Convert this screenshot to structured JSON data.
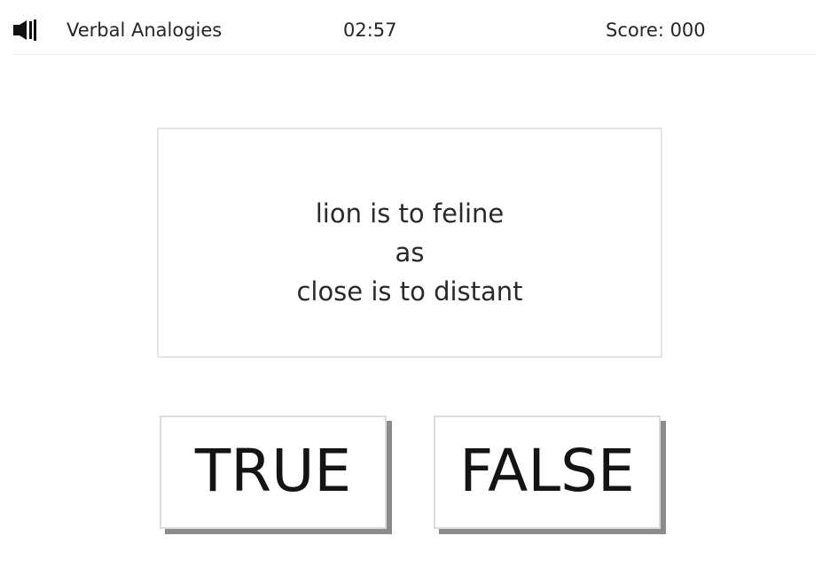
{
  "header": {
    "sound_icon": "speaker-icon",
    "title": "Verbal Analogies",
    "timer": "02:57",
    "score": "Score: 000"
  },
  "question": {
    "line1": "lion is to feline",
    "line2": "as",
    "line3": "close is to distant"
  },
  "answers": {
    "true_label": "TRUE",
    "false_label": "FALSE"
  },
  "colors": {
    "background": "#ffffff",
    "text": "#1e1e1e",
    "card_border": "#e4e4e4",
    "button_shadow": "#8c8c8c"
  }
}
